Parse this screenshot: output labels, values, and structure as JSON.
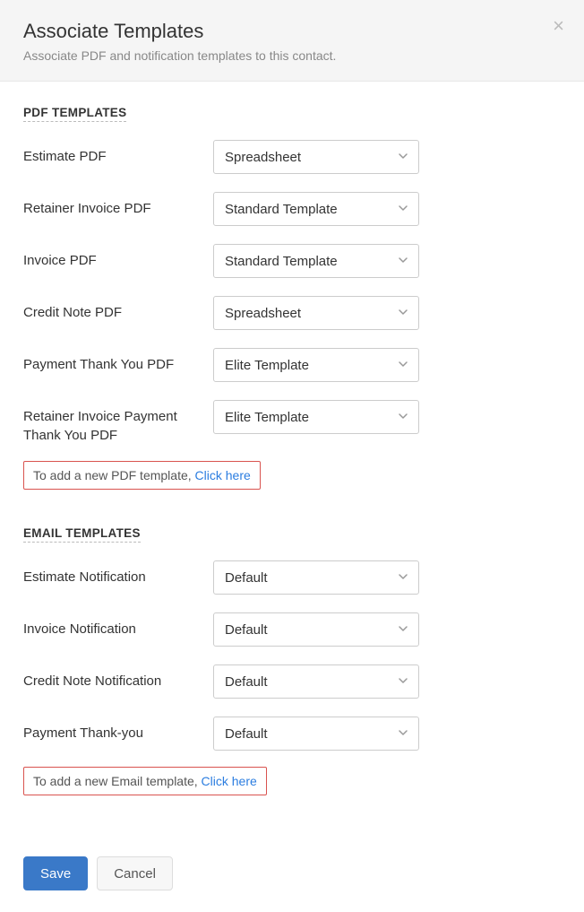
{
  "header": {
    "title": "Associate Templates",
    "subtitle": "Associate PDF and notification templates to this contact."
  },
  "sections": {
    "pdf": {
      "title": "PDF TEMPLATES",
      "rows": [
        {
          "label": "Estimate PDF",
          "value": "Spreadsheet"
        },
        {
          "label": "Retainer Invoice PDF",
          "value": "Standard Template"
        },
        {
          "label": "Invoice PDF",
          "value": "Standard Template"
        },
        {
          "label": "Credit Note PDF",
          "value": "Spreadsheet"
        },
        {
          "label": "Payment Thank You PDF",
          "value": "Elite Template"
        },
        {
          "label": "Retainer Invoice Payment Thank You PDF",
          "value": "Elite Template"
        }
      ],
      "helper_text": "To add a new PDF template, ",
      "helper_link": "Click here"
    },
    "email": {
      "title": "EMAIL TEMPLATES",
      "rows": [
        {
          "label": "Estimate Notification",
          "value": "Default"
        },
        {
          "label": "Invoice Notification",
          "value": "Default"
        },
        {
          "label": "Credit Note Notification",
          "value": "Default"
        },
        {
          "label": "Payment Thank-you",
          "value": "Default"
        }
      ],
      "helper_text": "To add a new Email template, ",
      "helper_link": "Click here"
    }
  },
  "footer": {
    "save_label": "Save",
    "cancel_label": "Cancel"
  }
}
